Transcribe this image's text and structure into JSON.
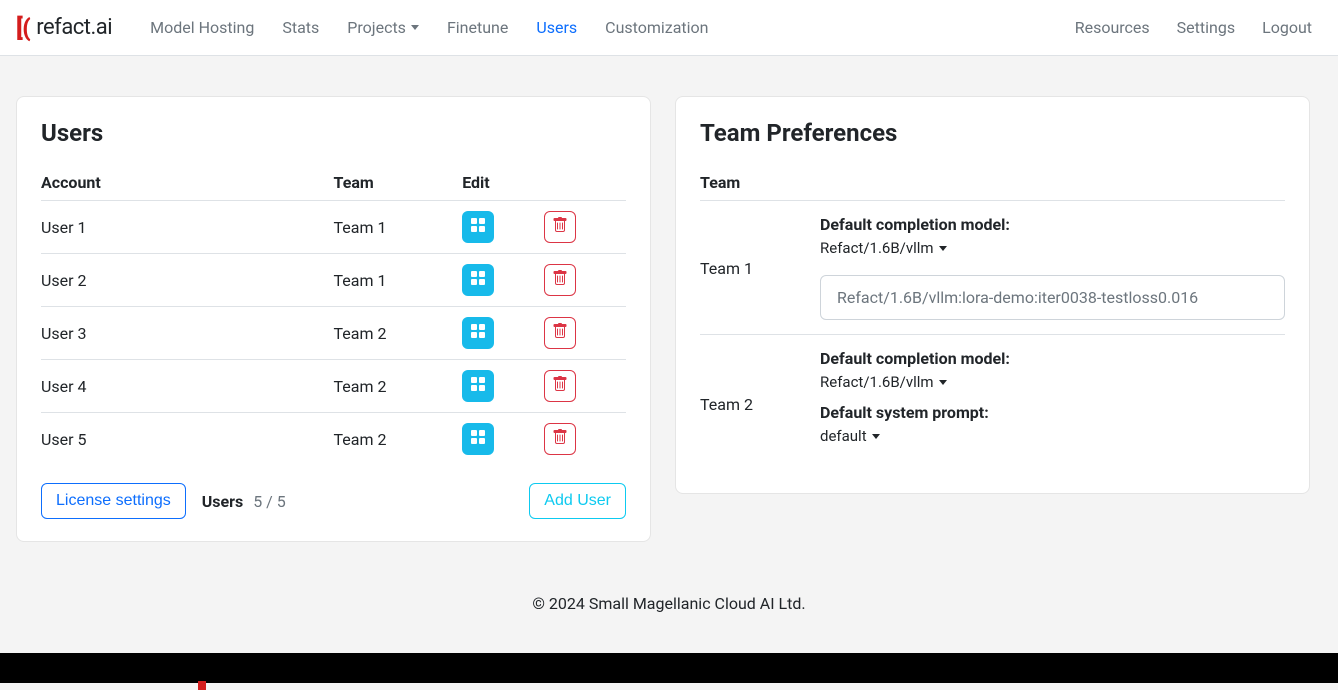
{
  "brand": {
    "name": "refact.ai"
  },
  "nav": {
    "model_hosting": "Model Hosting",
    "stats": "Stats",
    "projects": "Projects",
    "finetune": "Finetune",
    "users": "Users",
    "customization": "Customization",
    "resources": "Resources",
    "settings": "Settings",
    "logout": "Logout"
  },
  "users_panel": {
    "title": "Users",
    "columns": {
      "account": "Account",
      "team": "Team",
      "edit": "Edit"
    },
    "rows": [
      {
        "account": "User 1",
        "team": "Team 1"
      },
      {
        "account": "User 2",
        "team": "Team 1"
      },
      {
        "account": "User 3",
        "team": "Team 2"
      },
      {
        "account": "User 4",
        "team": "Team 2"
      },
      {
        "account": "User 5",
        "team": "Team 2"
      }
    ],
    "license_button": "License settings",
    "users_label": "Users",
    "users_count": "5 / 5",
    "add_user": "Add User"
  },
  "prefs_panel": {
    "title": "Team Preferences",
    "team_header": "Team",
    "teams": [
      {
        "name": "Team 1",
        "completion_label": "Default completion model:",
        "completion_value": "Refact/1.6B/vllm",
        "well_text": "Refact/1.6B/vllm:lora-demo:iter0038-testloss0.016"
      },
      {
        "name": "Team 2",
        "completion_label": "Default completion model:",
        "completion_value": "Refact/1.6B/vllm",
        "prompt_label": "Default system prompt:",
        "prompt_value": "default"
      }
    ]
  },
  "footer": "© 2024 Small Magellanic Cloud AI Ltd."
}
